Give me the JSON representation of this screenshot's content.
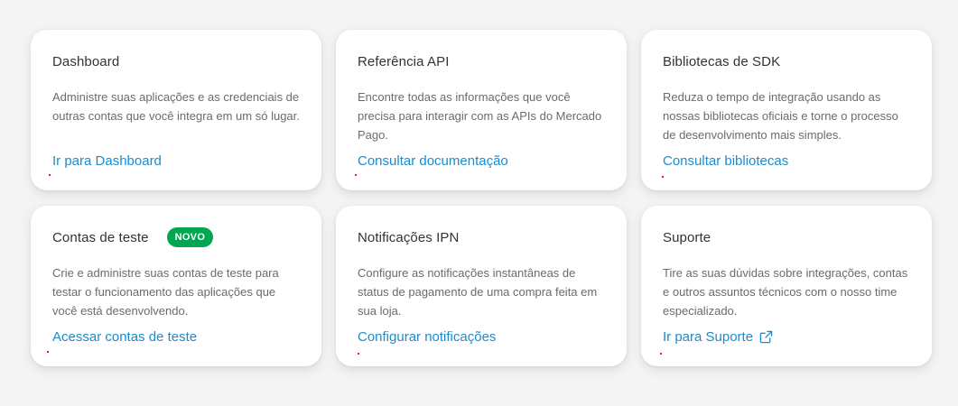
{
  "cards": [
    {
      "title": "Dashboard",
      "description": "Administre suas aplicações e as credenciais de outras contas que você integra em um só lugar.",
      "link": "Ir para Dashboard"
    },
    {
      "title": "Referência API",
      "description": "Encontre todas as informações que você precisa para interagir com as APIs do Mercado Pago.",
      "link": "Consultar documentação"
    },
    {
      "title": "Bibliotecas de SDK",
      "description": "Reduza o tempo de integração usando as nossas bibliotecas oficiais e torne o processo de desenvolvimento mais simples.",
      "link": "Consultar bibliotecas"
    },
    {
      "title": "Contas de teste",
      "badge": "NOVO",
      "description": "Crie e administre suas contas de teste para testar o funcionamento das aplicações que você está desenvolvendo.",
      "link": "Acessar contas de teste"
    },
    {
      "title": "Notificações IPN",
      "description": "Configure as notificações instantâneas de status de pagamento de uma compra feita em sua loja.",
      "link": "Configurar notificações"
    },
    {
      "title": "Suporte",
      "description": "Tire as suas dúvidas sobre integrações, contas e outros assuntos técnicos com o nosso time especializado.",
      "link": "Ir para Suporte",
      "link_icon": "external-link-icon"
    }
  ],
  "colors": {
    "background": "#f4f4f4",
    "card": "#ffffff",
    "title": "#333333",
    "description": "#6b6b6b",
    "link": "#1a8ccf",
    "badge": "#00a650"
  }
}
